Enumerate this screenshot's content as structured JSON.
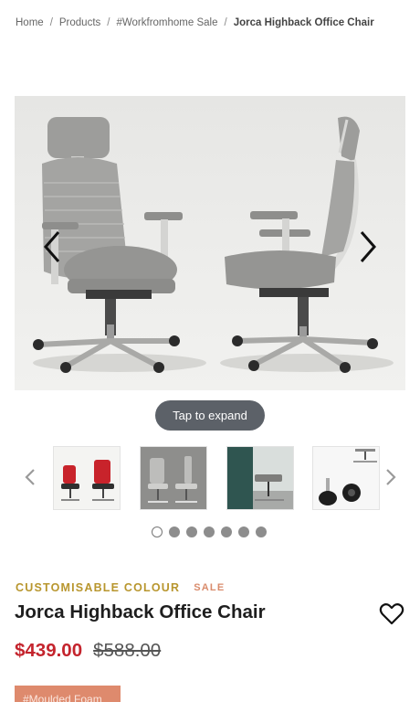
{
  "breadcrumb": {
    "items": [
      "Home",
      "Products",
      "#Workfromhome Sale"
    ],
    "current": "Jorca Highback Office Chair",
    "separator": "/"
  },
  "gallery": {
    "expand_label": "Tap to expand",
    "dot_count": 7,
    "active_dot": 1
  },
  "product": {
    "tag_colour": "CUSTOMISABLE COLOUR",
    "tag_sale": "SALE",
    "title": "Jorca Highback Office Chair",
    "price_sale": "$439.00",
    "price_original": "$588.00",
    "badge": "#Moulded Foam"
  },
  "colors": {
    "sale_price": "#c4242d",
    "tag_gold": "#b8962e",
    "sale_tag": "#d98b6b",
    "badge_bg": "#de8a6d",
    "pill_bg": "#5c6168"
  },
  "icons": {
    "gallery_prev": "chevron-left-icon",
    "gallery_next": "chevron-right-icon",
    "thumb_prev": "chevron-left-icon",
    "thumb_next": "chevron-right-icon",
    "wishlist": "heart-icon"
  }
}
